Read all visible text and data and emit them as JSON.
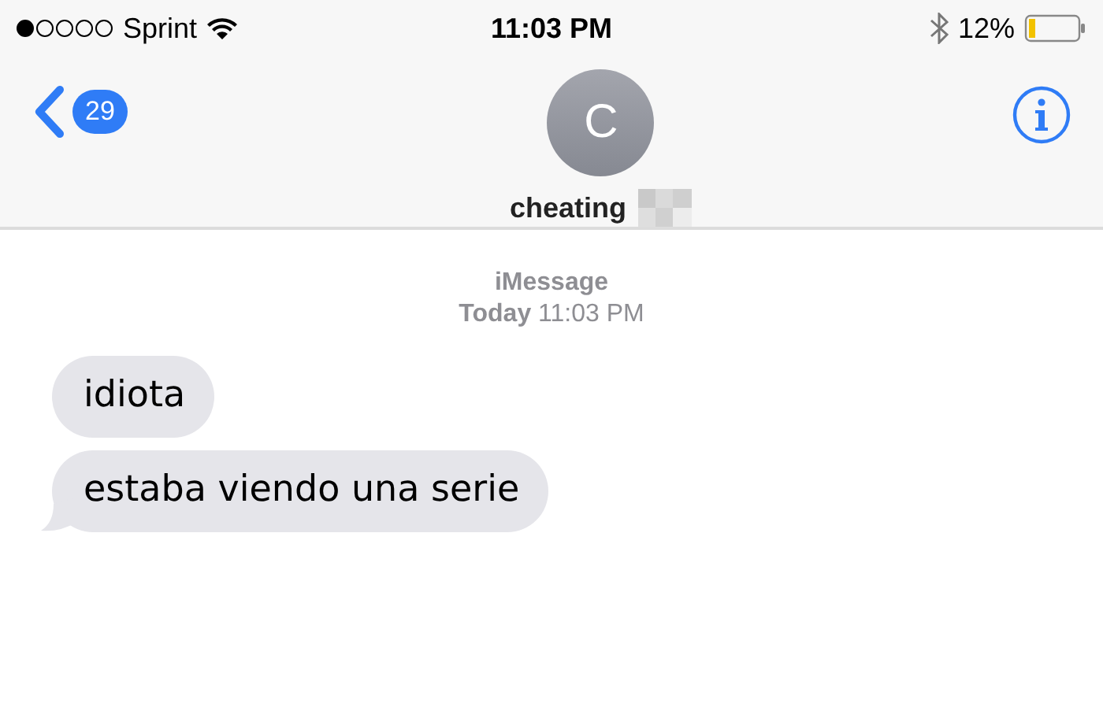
{
  "status_bar": {
    "carrier": "Sprint",
    "time": "11:03 PM",
    "battery_percent": "12%"
  },
  "nav": {
    "unread_count": "29",
    "avatar_initial": "C",
    "contact_name": "cheating"
  },
  "conversation": {
    "service": "iMessage",
    "day": "Today",
    "time": "11:03 PM",
    "messages": [
      {
        "text": "idiota",
        "tail": false
      },
      {
        "text": "estaba viendo una serie",
        "tail": true
      }
    ]
  }
}
